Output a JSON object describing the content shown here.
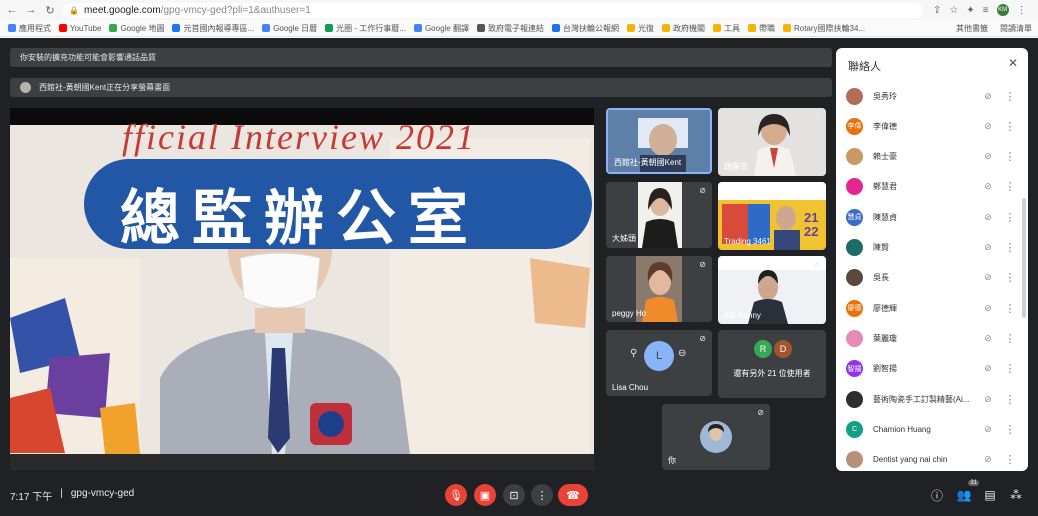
{
  "browser": {
    "url_host": "meet.google.com",
    "url_path": "/gpg-vmcy-ged?pli=1&authuser=1",
    "profile_initials": "KM",
    "bookmarks": [
      {
        "label": "應用程式",
        "color": "#4285f4"
      },
      {
        "label": "YouTube",
        "color": "#ff0000"
      },
      {
        "label": "Google 地圖",
        "color": "#34a853"
      },
      {
        "label": "元首國內報導專區...",
        "color": "#1877f2"
      },
      {
        "label": "Google 日曆",
        "color": "#4285f4"
      },
      {
        "label": "光圈 - 工作行事曆...",
        "color": "#0f9d58"
      },
      {
        "label": "Google 翻譯",
        "color": "#4285f4"
      },
      {
        "label": "致府電子報連結",
        "color": "#555555"
      },
      {
        "label": "台灣扶輪公報網",
        "color": "#1a73e8"
      },
      {
        "label": "光復",
        "color": "#f4b400"
      },
      {
        "label": "政府機關",
        "color": "#f4b400"
      },
      {
        "label": "工具",
        "color": "#f4b400"
      },
      {
        "label": "帶職",
        "color": "#f4b400"
      },
      {
        "label": "Rotary國際扶輪34...",
        "color": "#f4b400"
      }
    ],
    "bookmarks_right": [
      "其他書籤",
      "閱讀清單"
    ]
  },
  "meet": {
    "banner_notice": "你安裝的擴充功能可能會影響通話品質",
    "banner_presenting": "西館社-黃朝國Kent正在分享螢幕畫面",
    "main_video": {
      "english_title": "fficial Interview 2021",
      "chinese_title": "總監辦公室"
    },
    "tiles": [
      {
        "label": "西館社-黃朝國Kent",
        "muted": false
      },
      {
        "label": "趙靜雯",
        "muted": false
      },
      {
        "label": "大姊頭",
        "muted": true
      },
      {
        "label": "Trading 3461",
        "muted": false
      },
      {
        "label": "peggy Ho",
        "muted": true
      },
      {
        "label": "AM Kenny",
        "muted": false
      },
      {
        "label": "Lisa Chou",
        "muted": true
      },
      {
        "label": "還有另外 21 位使用者",
        "muted": false
      },
      {
        "label": "你",
        "muted": true
      }
    ],
    "others_avatars": [
      {
        "initial": "R",
        "color": "#34a853"
      },
      {
        "initial": "D",
        "color": "#a1552f"
      }
    ],
    "bottom": {
      "time": "7:17 下午",
      "separator": "|",
      "meeting_code": "gpg-vmcy-ged",
      "people_badge": "31"
    }
  },
  "people_panel": {
    "title": "聯絡人",
    "people": [
      {
        "name": "吳秀玲",
        "initial": "",
        "color": "#b26d57"
      },
      {
        "name": "李偉德",
        "initial": "李偉",
        "color": "#e8710a"
      },
      {
        "name": "賴士豪",
        "initial": "",
        "color": "#c99a63"
      },
      {
        "name": "鄭慧君",
        "initial": "",
        "color": "#e52592"
      },
      {
        "name": "陳慧貞",
        "initial": "慧貞",
        "color": "#3c6cc9"
      },
      {
        "name": "陳賢",
        "initial": "",
        "color": "#1e6a64"
      },
      {
        "name": "吳長",
        "initial": "",
        "color": "#5b4a3b"
      },
      {
        "name": "廖德輝",
        "initial": "廖德",
        "color": "#e8710a"
      },
      {
        "name": "葉麗瓊",
        "initial": "",
        "color": "#e889b7"
      },
      {
        "name": "劉智揚",
        "initial": "智揚",
        "color": "#9334e6"
      },
      {
        "name": "藝術陶瓷手工訂製精藝(Ai...",
        "initial": "",
        "color": "#2e2e2e"
      },
      {
        "name": "Chamion Huang",
        "initial": "C",
        "color": "#12a085"
      },
      {
        "name": "Dentist yang nai chin",
        "initial": "",
        "color": "#b8907a"
      }
    ]
  },
  "icons": {
    "mic_off": "mic-off-icon",
    "more": "more-vert-icon",
    "close": "close-icon"
  }
}
